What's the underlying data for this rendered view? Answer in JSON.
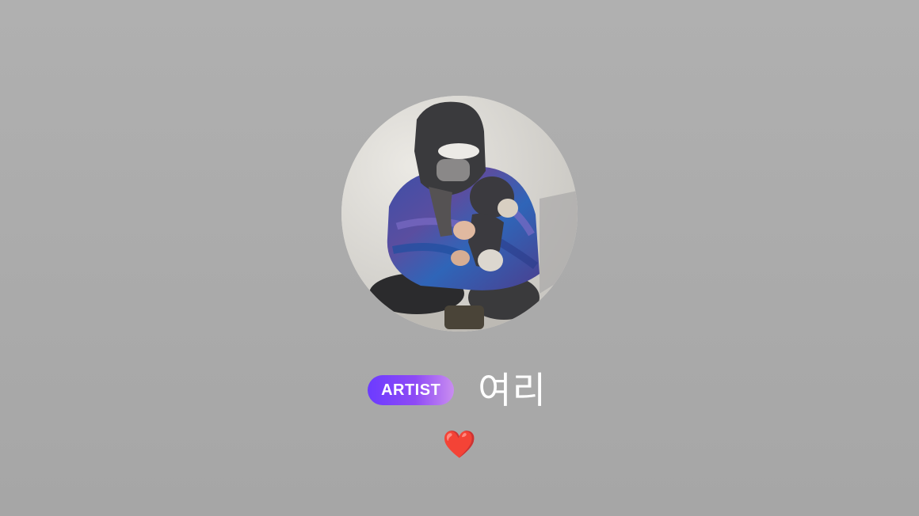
{
  "profile": {
    "avatar_icon": "profile-photo-person-holding-dog",
    "badge_label": "ARTIST",
    "display_name": "여리",
    "status_emoji": "❤️"
  },
  "colors": {
    "background": "#aeaeae",
    "badge_gradient_start": "#6c3bff",
    "badge_gradient_end": "#c98df0",
    "name_text": "#ffffff",
    "heart": "#e3283a"
  }
}
